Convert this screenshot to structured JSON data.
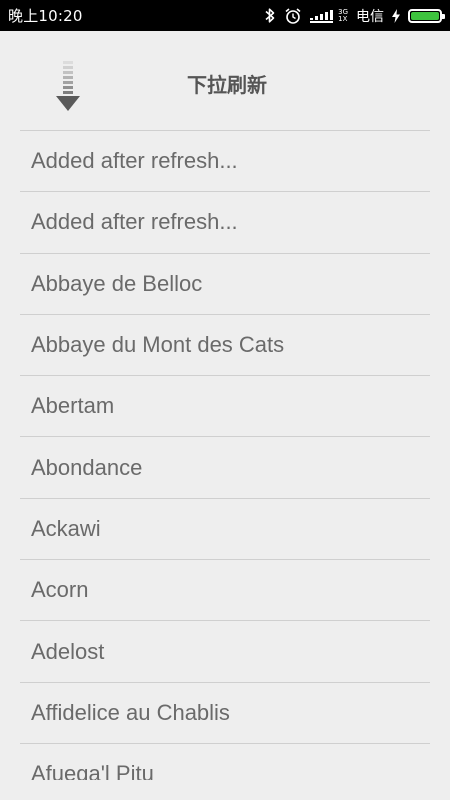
{
  "status_bar": {
    "time": "晚上10:20",
    "network_top": "3G",
    "network_bottom": "1X",
    "carrier": "电信",
    "battery_level": 1.0,
    "battery_color": "#3ec33e",
    "icons": [
      "bluetooth-icon",
      "alarm-clock-icon",
      "signal-bars-icon",
      "charging-bolt-icon",
      "battery-icon"
    ]
  },
  "pull_to_refresh": {
    "label": "下拉刷新",
    "icon": "pull-down-arrow-icon"
  },
  "list": {
    "items": [
      "Added after refresh...",
      "Added after refresh...",
      "Abbaye de Belloc",
      "Abbaye du Mont des Cats",
      "Abertam",
      "Abondance",
      "Ackawi",
      "Acorn",
      "Adelost",
      "Affidelice au Chablis",
      "Afuega'l Pitu"
    ]
  }
}
